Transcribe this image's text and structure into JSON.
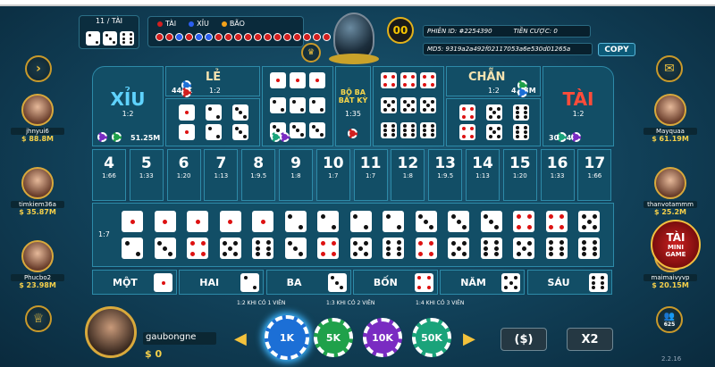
{
  "history": {
    "label": "11 / TÀI"
  },
  "legend": {
    "tai": "TÀI",
    "xiu": "XỈU",
    "bao": "BÃO",
    "colors": {
      "tai": "#d11f1f",
      "xiu": "#2a5ef0",
      "bao": "#f3a21a"
    },
    "balls": [
      "red",
      "red",
      "blue",
      "red",
      "blue",
      "blue",
      "red",
      "red",
      "red",
      "red",
      "red",
      "red",
      "red",
      "red",
      "red",
      "red",
      "red",
      "red"
    ]
  },
  "timer": "00",
  "session": {
    "id_label": "PHIÊN ID:",
    "id_value": "#2254390",
    "bet_label": "TIỀN CƯỢC:",
    "bet_value": "0",
    "md5_label": "MD5:",
    "md5_value": "9319a2a492f02117053a6e530d01265a",
    "copy": "COPY"
  },
  "players_left": [
    {
      "name": "jhnyui6",
      "money": "$ 88.8M"
    },
    {
      "name": "timkiem36a",
      "money": "$ 35.87M"
    },
    {
      "name": "Phucbo2",
      "money": "$ 23.98M"
    }
  ],
  "players_right": [
    {
      "name": "Mayquaa",
      "money": "$ 61.19M"
    },
    {
      "name": "thanvotammm",
      "money": "$ 25.2M"
    },
    {
      "name": "maimaivyvp",
      "money": "$ 20.15M"
    }
  ],
  "online_count": "625",
  "table": {
    "xiu": {
      "label": "XỈU",
      "odds": "1:2",
      "amount": "51.25M"
    },
    "tai": {
      "label": "TÀI",
      "odds": "1:2",
      "amount": "30.04M"
    },
    "le": {
      "label": "LẺ",
      "amount": "446K",
      "odds": "1:2"
    },
    "chan": {
      "label": "CHẴN",
      "odds": "1:2",
      "amount": "4.13M"
    },
    "triple_any": {
      "label1": "BỘ BA",
      "label2": "BẤT KỲ",
      "odds": "1:35"
    },
    "totals": [
      {
        "n": "4",
        "o": "1:66"
      },
      {
        "n": "5",
        "o": "1:33"
      },
      {
        "n": "6",
        "o": "1:20"
      },
      {
        "n": "7",
        "o": "1:13"
      },
      {
        "n": "8",
        "o": "1:9.5"
      },
      {
        "n": "9",
        "o": "1:8"
      },
      {
        "n": "10",
        "o": "1:7"
      },
      {
        "n": "11",
        "o": "1:7"
      },
      {
        "n": "12",
        "o": "1:8"
      },
      {
        "n": "13",
        "o": "1:9.5"
      },
      {
        "n": "14",
        "o": "1:13"
      },
      {
        "n": "15",
        "o": "1:20"
      },
      {
        "n": "16",
        "o": "1:33"
      },
      {
        "n": "17",
        "o": "1:66"
      }
    ],
    "combo_odds": "1:7",
    "singles": [
      {
        "label": "MỘT",
        "face": 1
      },
      {
        "label": "HAI",
        "face": 2
      },
      {
        "label": "BA",
        "face": 3
      },
      {
        "label": "BỐN",
        "face": 4
      },
      {
        "label": "NĂM",
        "face": 5
      },
      {
        "label": "SÁU",
        "face": 6
      }
    ],
    "footnotes": [
      "1:2  KHI CÓ 1 VIÊN",
      "1:3  KHI CÓ 2 VIÊN",
      "1:4  KHI CÓ 3 VIÊN"
    ]
  },
  "me": {
    "name": "gaubongne",
    "money": "$ 0"
  },
  "chips": [
    {
      "label": "1K",
      "color": "#1c6fd6"
    },
    {
      "label": "5K",
      "color": "#1fa14a"
    },
    {
      "label": "10K",
      "color": "#7a2bc2"
    },
    {
      "label": "50K",
      "color": "#1aa37a"
    }
  ],
  "actions": {
    "rebet": "($)",
    "double": "X2"
  },
  "minigame": {
    "l1": "TÀI",
    "l2": "MINI",
    "l3": "GAME"
  },
  "version": "2.2.16"
}
